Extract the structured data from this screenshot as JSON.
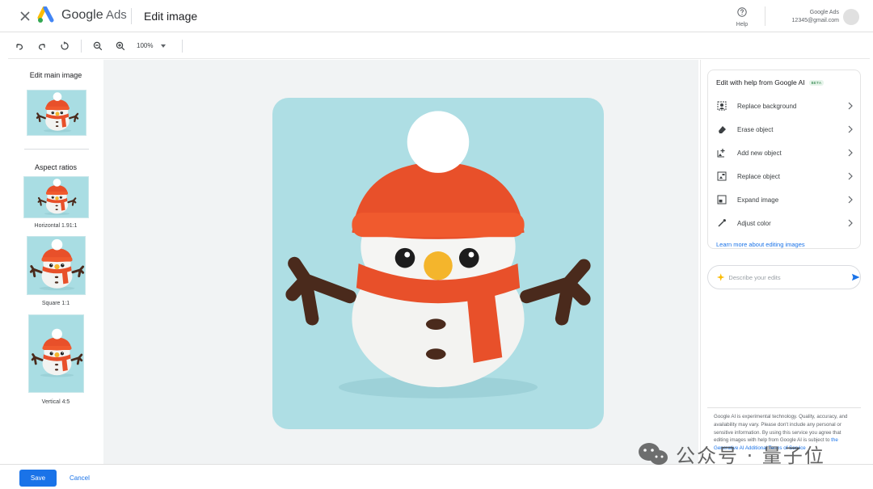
{
  "header": {
    "brand_prefix": "Google",
    "brand_suffix": "Ads",
    "title": "Edit image",
    "help_label": "Help",
    "account_name": "Google Ads",
    "account_email": "12345@gmail.com"
  },
  "toolbar": {
    "zoom_level": "100%"
  },
  "left_panel": {
    "main_heading": "Edit main image",
    "aspect_heading": "Aspect ratios",
    "ratios": [
      {
        "label": "Horizontal 1.91:1"
      },
      {
        "label": "Square 1:1"
      },
      {
        "label": "Vertical 4:5"
      }
    ]
  },
  "ai_panel": {
    "title": "Edit with help from Google AI",
    "beta": "BETA",
    "items": [
      {
        "label": "Replace background",
        "icon": "replace-background-icon"
      },
      {
        "label": "Erase object",
        "icon": "eraser-icon"
      },
      {
        "label": "Add new object",
        "icon": "add-object-icon"
      },
      {
        "label": "Replace object",
        "icon": "replace-object-icon"
      },
      {
        "label": "Expand image",
        "icon": "expand-image-icon"
      },
      {
        "label": "Adjust color",
        "icon": "color-picker-icon"
      }
    ],
    "learn_more": "Learn more about editing images",
    "describe_placeholder": "Describe your edits",
    "disclaimer": "Google AI is experimental technology. Quality, accuracy, and availability may vary. Please don't include any personal or sensitive information. By using this service you agree that editing images with help from Google AI is subject to",
    "disclaimer_link": "the Generative AI Additional Terms of Service"
  },
  "footer": {
    "save_label": "Save",
    "cancel_label": "Cancel"
  },
  "watermark": {
    "text": "公众号 · 量子位"
  },
  "colors": {
    "accent": "#1a73e8",
    "image_background": "#aedee4",
    "canvas_background": "#f1f3f4"
  }
}
